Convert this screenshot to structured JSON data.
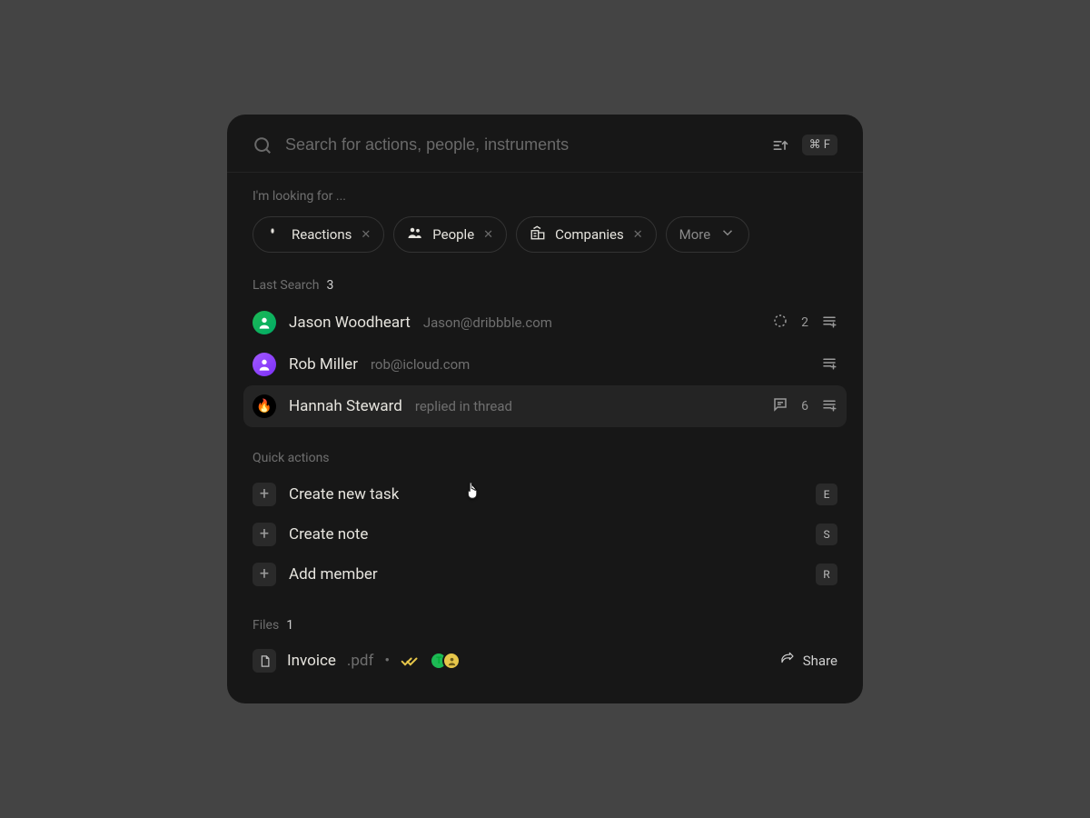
{
  "search": {
    "placeholder": "Search for actions, people, instruments",
    "shortcut": "⌘ F"
  },
  "looking_for_label": "I'm looking for ...",
  "chips": [
    {
      "label": "Reactions",
      "icon": "clap"
    },
    {
      "label": "People",
      "icon": "people"
    },
    {
      "label": "Companies",
      "icon": "building"
    }
  ],
  "more_label": "More",
  "last_search": {
    "label": "Last Search",
    "count": "3",
    "items": [
      {
        "name": "Jason Woodheart",
        "meta": "Jason@dribbble.com",
        "badge_count": "2",
        "has_circle_badge": true,
        "avatar": "green"
      },
      {
        "name": "Rob Miller",
        "meta": "rob@icloud.com",
        "avatar": "purple"
      },
      {
        "name": "Hannah Steward",
        "meta": "replied in thread",
        "thread_count": "6",
        "avatar": "fire",
        "hovered": true
      }
    ]
  },
  "quick_actions": {
    "label": "Quick actions",
    "items": [
      {
        "label": "Create new task",
        "key": "E"
      },
      {
        "label": "Create note",
        "key": "S"
      },
      {
        "label": "Add member",
        "key": "R"
      }
    ]
  },
  "files": {
    "label": "Files",
    "count": "1",
    "items": [
      {
        "name": "Invoice",
        "ext": ".pdf",
        "share_label": "Share"
      }
    ]
  }
}
